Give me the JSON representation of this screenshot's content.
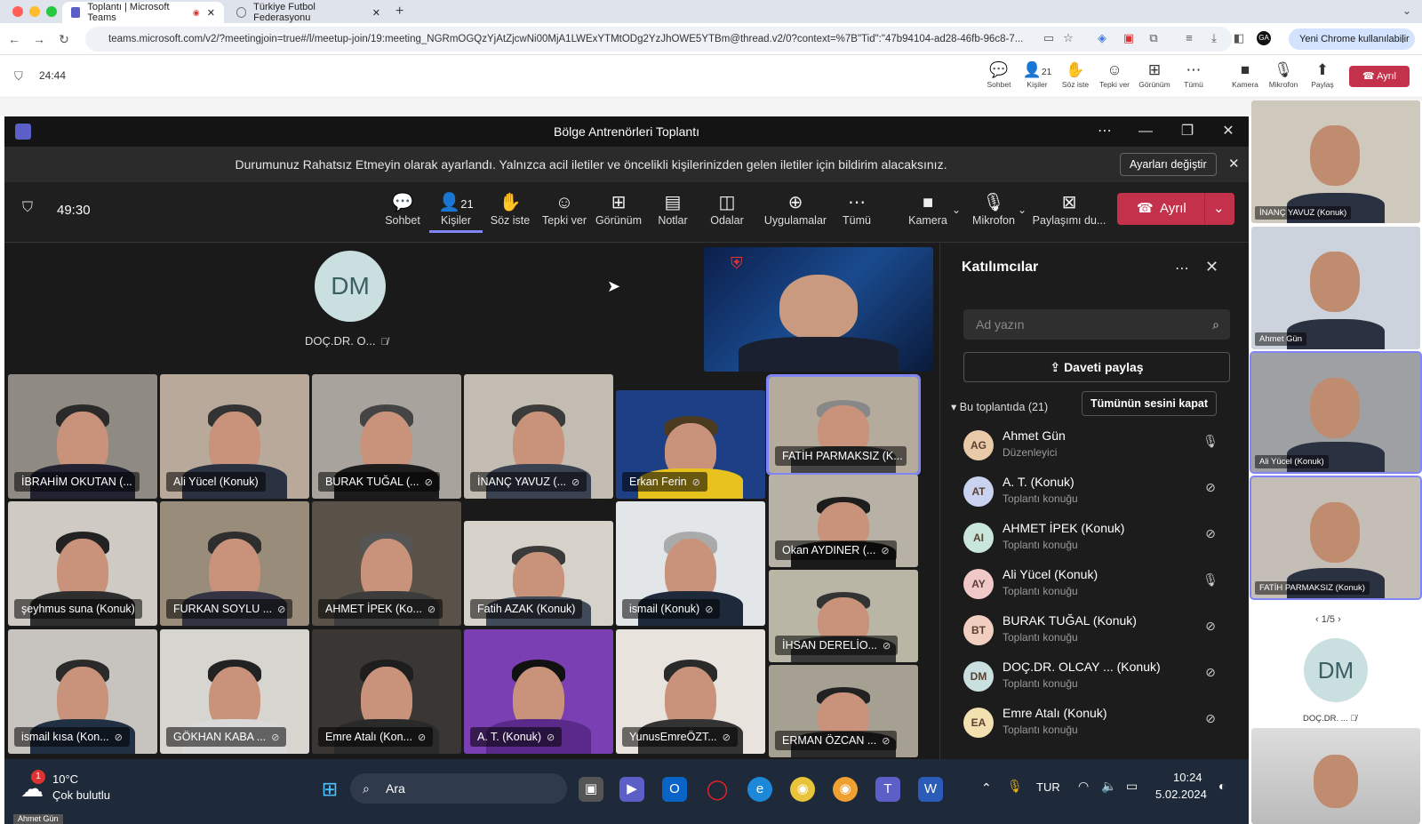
{
  "browser": {
    "tabs": [
      {
        "title": "Toplantı | Microsoft Teams"
      },
      {
        "title": "Türkiye Futbol Federasyonu"
      }
    ],
    "url": "teams.microsoft.com/v2/?meetingjoin=true#/l/meetup-join/19:meeting_NGRmOGQzYjAtZjcwNi00MjA1LWExYTMtODg2YzJhOWE5YTBm@thread.v2/0?context=%7B\"Tid\":\"47b94104-ad28-46fb-96c8-7...",
    "user_chip": "Yeni Chrome kullanılabilir"
  },
  "outer_bar": {
    "timer": "24:44",
    "buttons": [
      {
        "label": "Sohbet",
        "icon": "chat-icon"
      },
      {
        "label": "Kişiler",
        "icon": "people-icon",
        "count": "21"
      },
      {
        "label": "Söz iste",
        "icon": "raise-hand-icon"
      },
      {
        "label": "Tepki ver",
        "icon": "react-icon"
      },
      {
        "label": "Görünüm",
        "icon": "view-icon"
      },
      {
        "label": "Tümü",
        "icon": "more-icon"
      },
      {
        "label": "Kamera",
        "icon": "camera-icon"
      },
      {
        "label": "Mikrofon",
        "icon": "mic-off-icon"
      },
      {
        "label": "Paylaş",
        "icon": "share-icon"
      }
    ],
    "leave": "Ayrıl"
  },
  "window": {
    "title": "Bölge Antrenörleri Toplantı",
    "notification": "Durumunuz Rahatsız Etmeyin olarak ayarlandı. Yalnızca acil iletiler ve öncelikli kişilerinizden gelen iletiler için bildirim alacaksınız.",
    "notification_button": "Ayarları değiştir"
  },
  "toolbar": {
    "timer": "49:30",
    "people_count": "21",
    "buttons": [
      {
        "label": "Sohbet",
        "icon": "chat-icon"
      },
      {
        "label": "Kişiler",
        "icon": "people-icon"
      },
      {
        "label": "Söz iste",
        "icon": "raise-hand-icon"
      },
      {
        "label": "Tepki ver",
        "icon": "react-icon"
      },
      {
        "label": "Görünüm",
        "icon": "view-icon"
      },
      {
        "label": "Notlar",
        "icon": "notes-icon"
      },
      {
        "label": "Odalar",
        "icon": "rooms-icon"
      },
      {
        "label": "Uygulamalar",
        "icon": "apps-icon"
      },
      {
        "label": "Tümü",
        "icon": "more-icon"
      },
      {
        "label": "Kamera",
        "icon": "camera-icon"
      },
      {
        "label": "Mikrofon",
        "icon": "mic-icon"
      },
      {
        "label": "Paylaşımı du...",
        "icon": "stop-share-icon"
      }
    ],
    "leave": "Ayrıl"
  },
  "stage": {
    "avatar_initials": "DM",
    "avatar_name": "DOÇ.DR. O...",
    "tiles": [
      {
        "name": "İBRAHİM OKUTAN (..."
      },
      {
        "name": "Ali Yücel (Konuk)"
      },
      {
        "name": "BURAK TUĞAL (..."
      },
      {
        "name": "İNANÇ YAVUZ (..."
      },
      {
        "name": "Erkan Ferin"
      },
      {
        "name": "FATİH PARMAKSIZ (K..."
      },
      {
        "name": "şeyhmus suna (Konuk)"
      },
      {
        "name": "FURKAN SOYLU ..."
      },
      {
        "name": "AHMET İPEK (Ko..."
      },
      {
        "name": "Fatih AZAK (Konuk)"
      },
      {
        "name": "ismail (Konuk)"
      },
      {
        "name": "Okan AYDINER (..."
      },
      {
        "name": "ismail kısa (Kon..."
      },
      {
        "name": "GÖKHAN KABA ..."
      },
      {
        "name": "Emre Atalı (Kon..."
      },
      {
        "name": "A. T. (Konuk)"
      },
      {
        "name": "YunusEmreÖZT..."
      },
      {
        "name": "İHSAN DERELİO..."
      },
      {
        "name": "ERMAN ÖZCAN ..."
      }
    ]
  },
  "panel": {
    "title": "Katılımcılar",
    "search_placeholder": "Ad yazın",
    "share_invite": "Daveti paylaş",
    "in_meeting": "Bu toplantıda (21)",
    "mute_all": "Tümünün sesini kapat",
    "participants": [
      {
        "initials": "AG",
        "name": "Ahmet Gün",
        "role": "Düzenleyici",
        "mic": "on",
        "color": "#e8c9a8"
      },
      {
        "initials": "AT",
        "name": "A. T. (Konuk)",
        "role": "Toplantı konuğu",
        "mic": "off",
        "color": "#c9d3f0"
      },
      {
        "initials": "AI",
        "name": "AHMET İPEK (Konuk)",
        "role": "Toplantı konuğu",
        "mic": "off",
        "color": "#c9e6dc"
      },
      {
        "initials": "AY",
        "name": "Ali Yücel (Konuk)",
        "role": "Toplantı konuğu",
        "mic": "on",
        "color": "#f0c8c8"
      },
      {
        "initials": "BT",
        "name": "BURAK TUĞAL (Konuk)",
        "role": "Toplantı konuğu",
        "mic": "off",
        "color": "#f0cfc0"
      },
      {
        "initials": "DM",
        "name": "DOÇ.DR. OLCAY ... (Konuk)",
        "role": "Toplantı konuğu",
        "mic": "off",
        "color": "#c9dfe0"
      },
      {
        "initials": "EA",
        "name": "Emre Atalı (Konuk)",
        "role": "Toplantı konuğu",
        "mic": "off",
        "color": "#f2e0b0"
      }
    ]
  },
  "taskbar": {
    "weather_temp": "10°C",
    "weather_desc": "Çok bulutlu",
    "weather_badge": "1",
    "search": "Ara",
    "lang": "TUR",
    "time": "10:24",
    "date": "5.02.2024",
    "footer_name": "Ahmet Gün"
  },
  "strip": {
    "tiles": [
      {
        "name": "İNANÇ YAVUZ (Konuk)"
      },
      {
        "name": "Ahmet Gün"
      },
      {
        "name": "Ali Yücel (Konuk)"
      },
      {
        "name": "FATİH PARMAKSIZ (Konuk)"
      }
    ],
    "pager": "1/5",
    "avatar_initials": "DM",
    "avatar_name": "DOÇ.DR. ..."
  }
}
